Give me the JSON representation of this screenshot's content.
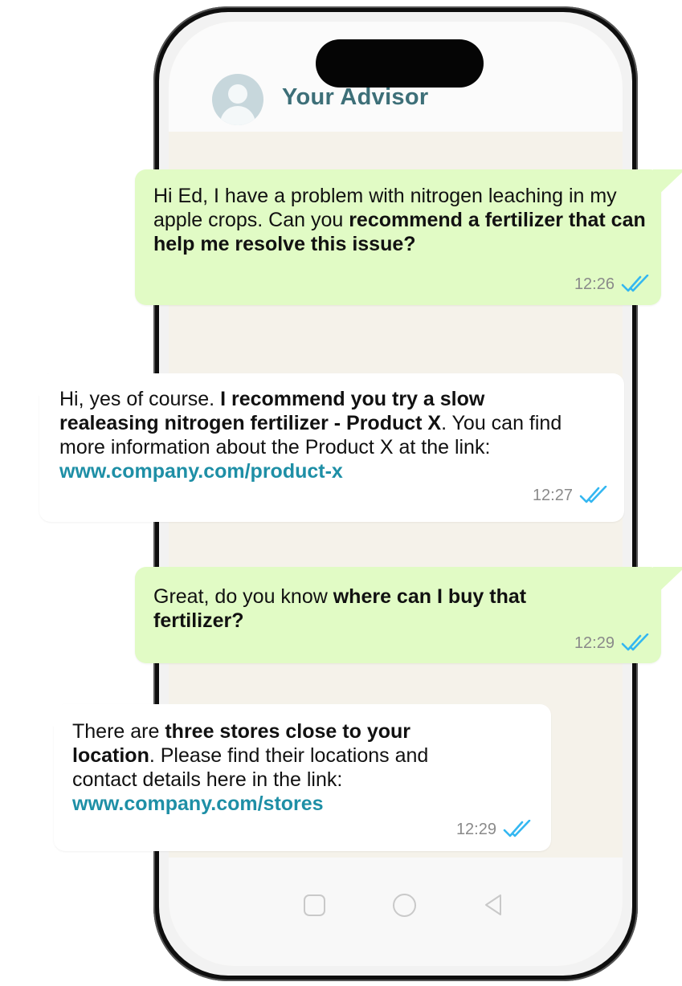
{
  "header": {
    "contact_name": "Your Advisor",
    "avatar_icon": "user-avatar-icon"
  },
  "messages": [
    {
      "direction": "outgoing",
      "text_before": "Hi Ed, I have a problem with nitrogen leaching in my apple crops. Can you ",
      "bold": "recommend a fertilizer that can help me resolve this issue?",
      "time": "12:26",
      "status_icon": "double-check-icon"
    },
    {
      "direction": "incoming",
      "text_before": "Hi, yes of course. ",
      "bold": "I recommend you try a slow realeasing nitrogen fertilizer - Product X",
      "text_after": ". You can find more information about the Product X at the link: ",
      "link": "www.company.com/product-x",
      "time": "12:27",
      "status_icon": "double-check-icon"
    },
    {
      "direction": "outgoing",
      "text_before": "Great, do you know ",
      "bold": "where can I buy that fertilizer?",
      "time": "12:29",
      "status_icon": "double-check-icon"
    },
    {
      "direction": "incoming",
      "text_before": "There are ",
      "bold": "three stores close to your location",
      "text_after": ". Please find their locations and contact details here in the link:",
      "link": "www.company.com/stores",
      "time": "12:29",
      "status_icon": "double-check-icon"
    }
  ],
  "navbar": {
    "icons": [
      "recent-apps-icon",
      "home-icon",
      "back-icon"
    ]
  },
  "colors": {
    "outgoing_bubble": "#e1fbc5",
    "incoming_bubble": "#ffffff",
    "chat_background": "#f5f2ea",
    "link": "#1e8fa6",
    "tick": "#34b7f1",
    "contact_name": "#3d6f78"
  }
}
